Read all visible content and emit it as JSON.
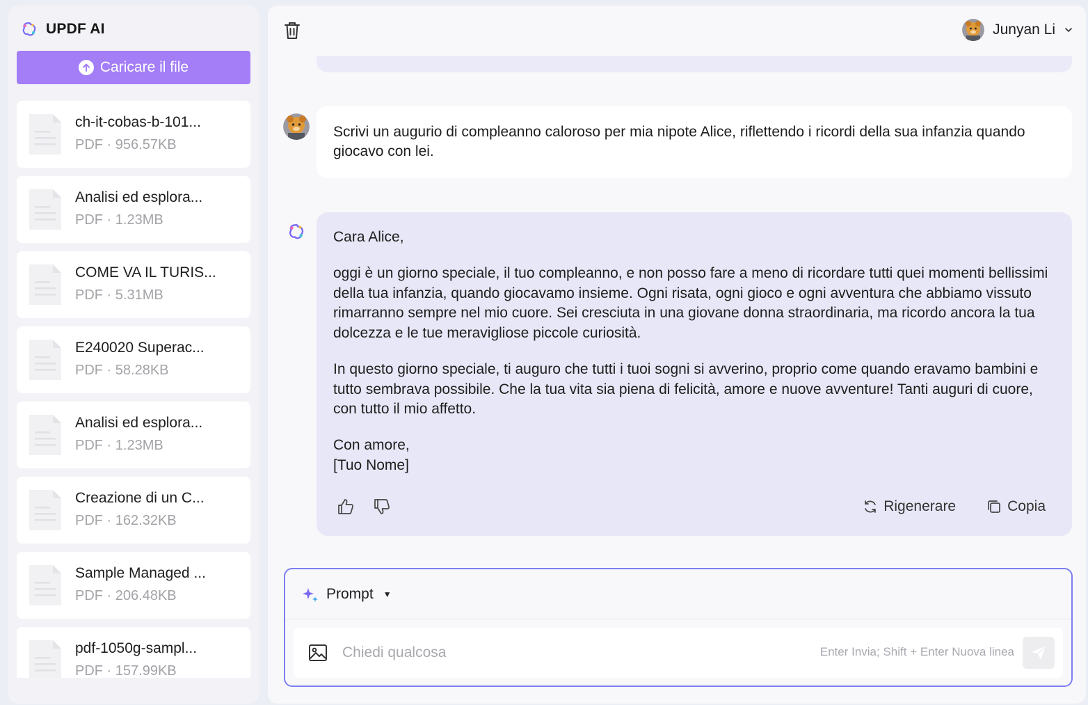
{
  "brand": {
    "name": "UPDF AI"
  },
  "sidebar": {
    "upload_label": "Caricare il file",
    "files": [
      {
        "name": "ch-it-cobas-b-101...",
        "meta": "PDF · 956.57KB"
      },
      {
        "name": "Analisi ed esplora...",
        "meta": "PDF · 1.23MB"
      },
      {
        "name": "COME VA IL TURIS...",
        "meta": "PDF · 5.31MB"
      },
      {
        "name": "E240020 Superac...",
        "meta": "PDF · 58.28KB"
      },
      {
        "name": "Analisi ed esplora...",
        "meta": "PDF · 1.23MB"
      },
      {
        "name": "Creazione di un C...",
        "meta": "PDF · 162.32KB"
      },
      {
        "name": "Sample Managed ...",
        "meta": "PDF · 206.48KB"
      },
      {
        "name": "pdf-1050g-sampl...",
        "meta": "PDF · 157.99KB"
      }
    ]
  },
  "header": {
    "user_name": "Junyan Li"
  },
  "chat": {
    "user_message": "Scrivi un augurio di compleanno caloroso per mia nipote Alice, riflettendo i ricordi della sua infanzia quando giocavo con lei.",
    "ai_greeting": "Cara Alice,",
    "ai_paragraph_1": "oggi è un giorno speciale, il tuo compleanno, e non posso fare a meno di ricordare tutti quei momenti bellissimi della tua infanzia, quando giocavamo insieme. Ogni risata, ogni gioco e ogni avventura che abbiamo vissuto rimarranno sempre nel mio cuore. Sei cresciuta in una giovane donna straordinaria, ma ricordo ancora la tua dolcezza e le tue meravigliose piccole curiosità.",
    "ai_paragraph_2": "In questo giorno speciale, ti auguro che tutti i tuoi sogni si avverino, proprio come quando eravamo bambini e tutto sembrava possibile. Che la tua vita sia piena di felicità, amore e nuove avventure! Tanti auguri di cuore, con tutto il mio affetto.",
    "ai_closing": "Con amore,",
    "ai_signature": "[Tuo Nome]",
    "regenerate_label": "Rigenerare",
    "copy_label": "Copia"
  },
  "composer": {
    "mode_label": "Prompt",
    "placeholder": "Chiedi qualcosa",
    "hint": "Enter Invia; Shift + Enter Nuova linea"
  },
  "colors": {
    "accent": "#a37ef7",
    "composer_border": "#7c7ef0",
    "ai_bubble": "#e8e7f7",
    "user_bubble": "#ffffff"
  },
  "icons": [
    "updf-logo-icon",
    "upload-arrow-icon",
    "pdf-file-icon",
    "trash-icon",
    "avatar",
    "chevron-down-icon",
    "thumbs-up-icon",
    "thumbs-down-icon",
    "regenerate-icon",
    "copy-icon",
    "sparkle-icon",
    "image-icon",
    "send-icon"
  ]
}
